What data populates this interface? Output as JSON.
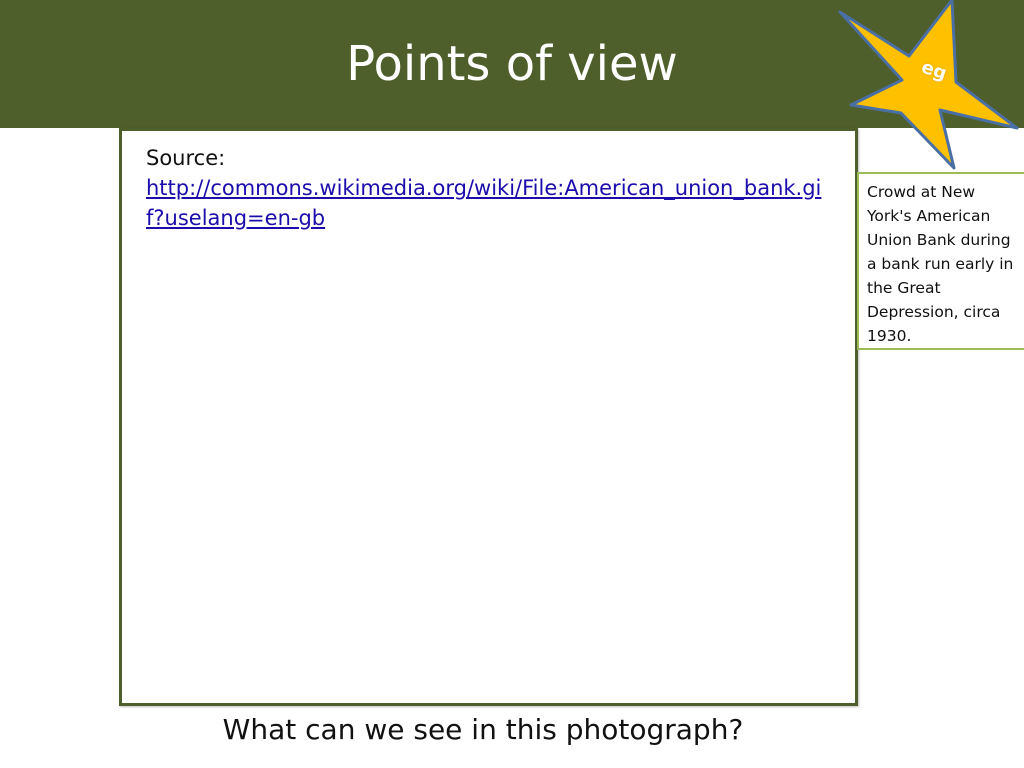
{
  "slide": {
    "title": "Points of view",
    "star_label": "eg",
    "source_label": "Source:",
    "source_url": "http://commons.wikimedia.org/wiki/File:American_union_bank.gif?uselang=en-gb",
    "caption": "Crowd at New York's American Union Bank during a bank run early in the Great Depression, circa 1930.",
    "question": "What can we see in this photograph?"
  },
  "colors": {
    "title_bar": "#4f5f2b",
    "star_fill": "#ffc000",
    "star_stroke": "#4a6fa5",
    "caption_border": "#9bbb59",
    "link": "#1a0dab"
  },
  "icons": {
    "star": "star-icon"
  }
}
